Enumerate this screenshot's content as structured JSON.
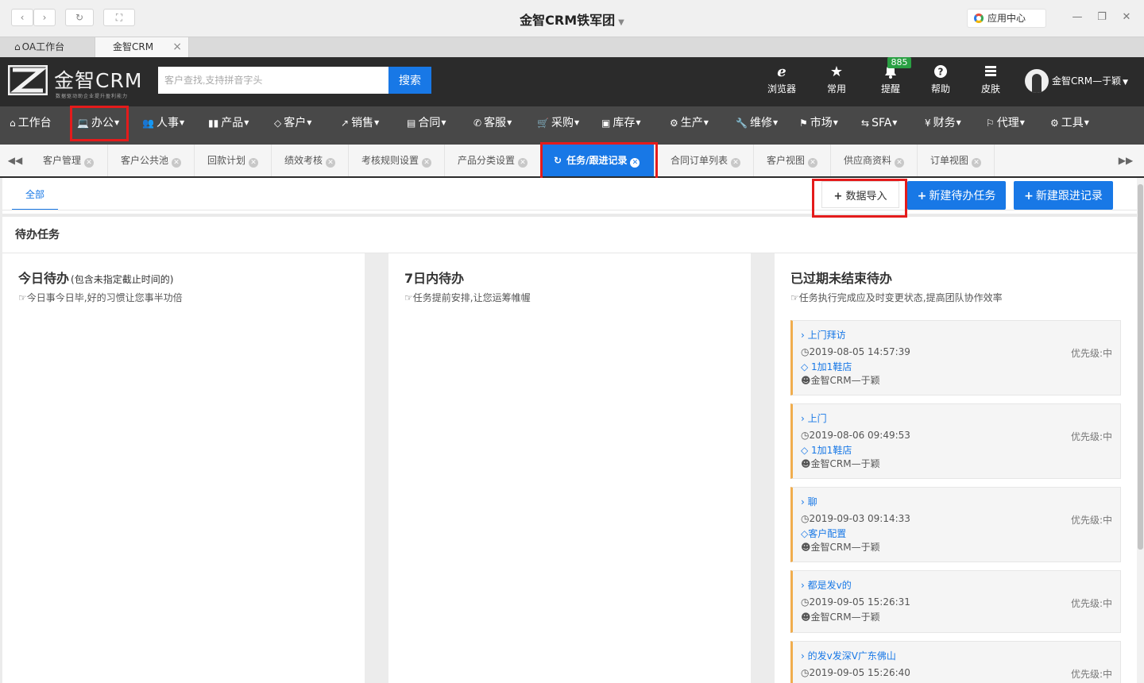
{
  "browser": {
    "title": "金智CRM铁军团",
    "app_center": "应用中心",
    "tabs": [
      {
        "label": "OA工作台"
      },
      {
        "label": "金智CRM"
      }
    ]
  },
  "header": {
    "brand": "金智CRM",
    "slogan": "数据驱动助企业提升盈利能力",
    "search_placeholder": "客户查找,支持拼音字头",
    "search_button": "搜索",
    "actions": [
      {
        "label": "浏览器",
        "icon": "ie-browser-icon"
      },
      {
        "label": "常用",
        "icon": "star-icon"
      },
      {
        "label": "提醒",
        "icon": "bell-icon"
      },
      {
        "label": "帮助",
        "icon": "help-icon"
      },
      {
        "label": "皮肤",
        "icon": "skin-icon"
      }
    ],
    "notify_count": "885",
    "user_name": "金智CRM—于颖"
  },
  "nav": {
    "items": [
      {
        "label": "工作台",
        "icon": "home-icon"
      },
      {
        "label": "办公",
        "icon": "laptop-icon"
      },
      {
        "label": "人事",
        "icon": "users-icon"
      },
      {
        "label": "产品",
        "icon": "barcode-icon"
      },
      {
        "label": "客户",
        "icon": "diamond-icon"
      },
      {
        "label": "销售",
        "icon": "line-chart-icon"
      },
      {
        "label": "合同",
        "icon": "newspaper-icon"
      },
      {
        "label": "客服",
        "icon": "phone-icon"
      },
      {
        "label": "采购",
        "icon": "cart-icon"
      },
      {
        "label": "库存",
        "icon": "cubes-icon"
      },
      {
        "label": "生产",
        "icon": "cogs-icon"
      },
      {
        "label": "维修",
        "icon": "wrench-icon"
      },
      {
        "label": "市场",
        "icon": "bookmark-icon"
      },
      {
        "label": "SFA",
        "icon": "retweet-icon"
      },
      {
        "label": "财务",
        "icon": "yen-icon"
      },
      {
        "label": "代理",
        "icon": "flag-icon"
      },
      {
        "label": "工具",
        "icon": "gear-icon"
      }
    ]
  },
  "page_tabs": [
    {
      "label": "客户管理"
    },
    {
      "label": "客户公共池"
    },
    {
      "label": "回款计划"
    },
    {
      "label": "绩效考核"
    },
    {
      "label": "考核规则设置"
    },
    {
      "label": "产品分类设置"
    },
    {
      "label": "任务/跟进记录",
      "active": true
    },
    {
      "label": "合同订单列表"
    },
    {
      "label": "客户视图"
    },
    {
      "label": "供应商资料"
    },
    {
      "label": "订单视图"
    }
  ],
  "content": {
    "subtab": "全部",
    "buttons": {
      "import": "数据导入",
      "new_task": "新建待办任务",
      "new_followup": "新建跟进记录"
    },
    "section_title": "待办任务",
    "columns": [
      {
        "title": "今日待办",
        "title_note": "(包含未指定截止时间的)",
        "subtitle": "今日事今日毕,好的习惯让您事半功倍"
      },
      {
        "title": "7日内待办",
        "subtitle": "任务提前安排,让您运筹帷幄"
      },
      {
        "title": "已过期未结束待办",
        "subtitle": "任务执行完成应及时变更状态,提高团队协作效率"
      }
    ],
    "overdue_cards": [
      {
        "title": "上门拜访",
        "time": "2019-08-05 14:57:39",
        "priority": "优先级:中",
        "customer": "1加1鞋店",
        "owner": "金智CRM—于颖"
      },
      {
        "title": "上门",
        "time": "2019-08-06 09:49:53",
        "priority": "优先级:中",
        "customer": "1加1鞋店",
        "owner": "金智CRM—于颖"
      },
      {
        "title": "聊",
        "time": "2019-09-03 09:14:33",
        "priority": "优先级:中",
        "customer": "客户配置",
        "owner": "金智CRM—于颖"
      },
      {
        "title": "都是发v的",
        "time": "2019-09-05 15:26:31",
        "priority": "优先级:中",
        "customer": "",
        "owner": "金智CRM—于颖"
      },
      {
        "title": "的发v发深V广东佛山",
        "time": "2019-09-05 15:26:40",
        "priority": "优先级:中",
        "customer": "",
        "owner": ""
      }
    ]
  },
  "colors": {
    "accent": "#1878e6",
    "header_bg": "#2b2b2b",
    "nav_bg": "#484848",
    "highlight": "#e41b1b",
    "card_border": "#f0ad4e"
  }
}
